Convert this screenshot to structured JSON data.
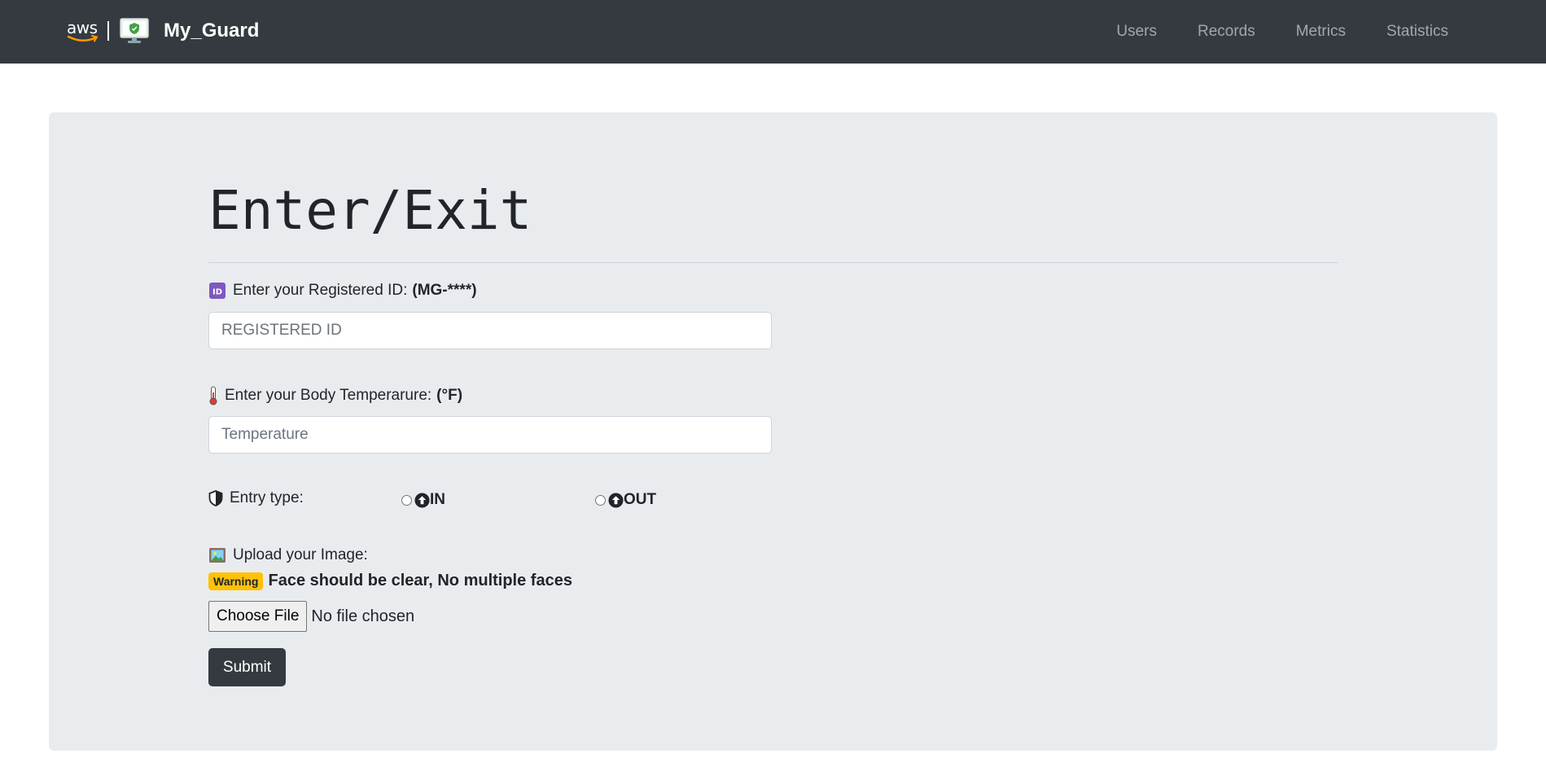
{
  "navbar": {
    "aws_logo_text": "aws",
    "brand_name": "My_Guard",
    "links": [
      "Users",
      "Records",
      "Metrics",
      "Statistics"
    ]
  },
  "form": {
    "title": "Enter/Exit",
    "registered_id": {
      "label": "Enter your Registered ID:",
      "format_hint": "(MG-****)",
      "placeholder": "REGISTERED ID",
      "value": ""
    },
    "temperature": {
      "label": "Enter your Body Temperarure:",
      "unit_hint": "(°F)",
      "placeholder": "Temperature",
      "value": ""
    },
    "entry_type": {
      "label": "Entry type:",
      "options": [
        "IN",
        "OUT"
      ],
      "selected": null
    },
    "upload": {
      "label": "Upload your Image:",
      "warning_badge": "Warning",
      "warning_text": "Face should be clear, No multiple faces",
      "button_label": "Choose File",
      "status": "No file chosen"
    },
    "submit_label": "Submit"
  },
  "colors": {
    "navbar_bg": "#343a40",
    "jumbotron_bg": "#e9ecef",
    "warning_badge": "#ffc107",
    "submit_bg": "#343a40"
  },
  "icons": {
    "registered_id": "id-button-emoji",
    "temperature": "thermometer-icon",
    "entry_type": "shield-half-icon",
    "entry_in": "arrow-up-circle-icon",
    "entry_out": "arrow-up-circle-icon",
    "upload": "framed-picture-emoji",
    "brand_monitor": "monitor-shield-icon"
  }
}
